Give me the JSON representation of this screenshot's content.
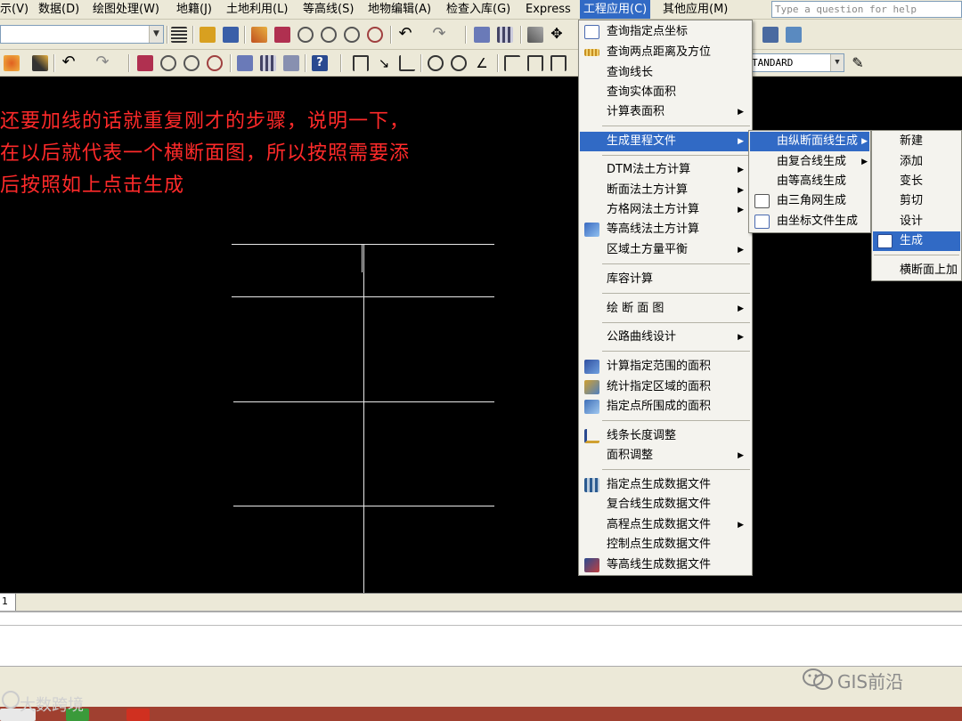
{
  "menubar": {
    "items": [
      "示(V)",
      "数据(D)",
      "绘图处理(W)",
      "地籍(J)",
      "土地利用(L)",
      "等高线(S)",
      "地物编辑(A)",
      "检查入库(G)",
      "Express",
      "工程应用(C)",
      "其他应用(M)"
    ],
    "help_placeholder": "Type a question for help"
  },
  "toolbar": {
    "style_value": "TANDARD"
  },
  "annotation": {
    "line1": "还要加线的话就重复刚才的步骤，说明一下，",
    "line2": "在以后就代表一个横断面图，所以按照需要添",
    "line3": "后按照如上点击生成"
  },
  "tabs": {
    "current": "1"
  },
  "main_menu": {
    "items": [
      {
        "label": "查询指定点坐标",
        "icon": "query-point-icon",
        "submenu": false
      },
      {
        "label": "查询两点距离及方位",
        "icon": "ruler-icon",
        "submenu": false
      },
      {
        "label": "查询线长",
        "icon": "",
        "submenu": false
      },
      {
        "label": "查询实体面积",
        "icon": "",
        "submenu": false
      },
      {
        "label": "计算表面积",
        "icon": "",
        "submenu": true
      },
      {
        "label": "生成里程文件",
        "icon": "",
        "submenu": true
      },
      {
        "label": "DTM法土方计算",
        "icon": "",
        "submenu": true
      },
      {
        "label": "断面法土方计算",
        "icon": "",
        "submenu": true
      },
      {
        "label": "方格网法土方计算",
        "icon": "",
        "submenu": true
      },
      {
        "label": "等高线法土方计算",
        "icon": "contour-volume-icon",
        "submenu": false
      },
      {
        "label": "区域土方量平衡",
        "icon": "",
        "submenu": true
      },
      {
        "label": "库容计算",
        "icon": "",
        "submenu": false
      },
      {
        "label": "绘 断 面 图",
        "icon": "",
        "submenu": true
      },
      {
        "label": "公路曲线设计",
        "icon": "",
        "submenu": true
      },
      {
        "label": "计算指定范围的面积",
        "icon": "area-range-icon",
        "submenu": false
      },
      {
        "label": "统计指定区域的面积",
        "icon": "area-stat-icon",
        "submenu": false
      },
      {
        "label": "指定点所围成的面积",
        "icon": "area-points-icon",
        "submenu": false
      },
      {
        "label": "线条长度调整",
        "icon": "line-adjust-icon",
        "submenu": false
      },
      {
        "label": "面积调整",
        "icon": "",
        "submenu": true
      },
      {
        "label": "指定点生成数据文件",
        "icon": "data-file-icon",
        "submenu": false
      },
      {
        "label": "复合线生成数据文件",
        "icon": "",
        "submenu": false
      },
      {
        "label": "高程点生成数据文件",
        "icon": "",
        "submenu": true
      },
      {
        "label": "控制点生成数据文件",
        "icon": "",
        "submenu": false
      },
      {
        "label": "等高线生成数据文件",
        "icon": "contour-data-icon",
        "submenu": false
      }
    ]
  },
  "sub_menu_1": {
    "items": [
      {
        "label": "由纵断面线生成",
        "submenu": true,
        "icon": ""
      },
      {
        "label": "由复合线生成",
        "submenu": true,
        "icon": ""
      },
      {
        "label": "由等高线生成",
        "submenu": false,
        "icon": ""
      },
      {
        "label": "由三角网生成",
        "submenu": false,
        "icon": "tin-icon"
      },
      {
        "label": "由坐标文件生成",
        "submenu": false,
        "icon": "coord-file-icon"
      }
    ]
  },
  "sub_menu_2": {
    "items": [
      {
        "label": "新建",
        "icon": ""
      },
      {
        "label": "添加",
        "icon": ""
      },
      {
        "label": "变长",
        "icon": ""
      },
      {
        "label": "剪切",
        "icon": ""
      },
      {
        "label": "设计",
        "icon": ""
      },
      {
        "label": "生成",
        "icon": "generate-icon"
      },
      {
        "label": "横断面上加",
        "icon": ""
      }
    ]
  },
  "watermarks": {
    "right": "GIS前沿",
    "left": "大数跨境"
  },
  "colors": {
    "highlight": "#316ac5",
    "annotation": "#ff2a2a",
    "menu_bg": "#f4f3ee"
  }
}
